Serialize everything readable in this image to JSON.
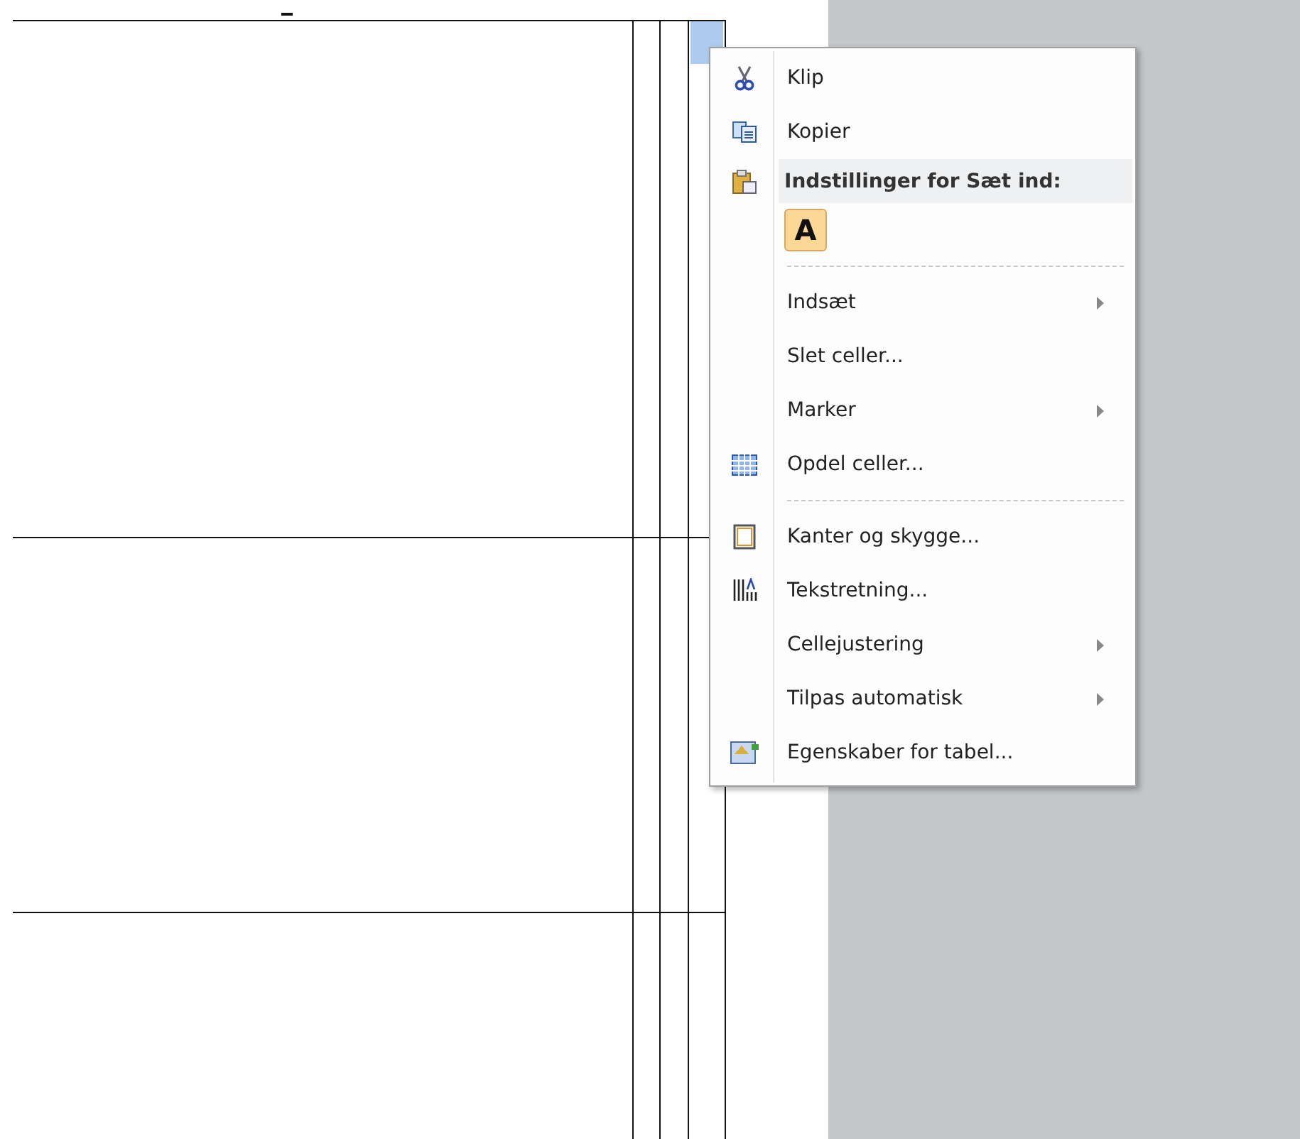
{
  "document": {
    "selected_cell": true
  },
  "context_menu": {
    "items": [
      {
        "kind": "item",
        "label": "Klip",
        "submenu": false
      },
      {
        "kind": "item",
        "label": "Kopier",
        "submenu": false
      },
      {
        "kind": "header",
        "label": "Indstillinger for Sæt ind:"
      },
      {
        "kind": "paste_options",
        "options": [
          "A"
        ]
      },
      {
        "kind": "separator"
      },
      {
        "kind": "item",
        "label": "Indsæt",
        "submenu": true
      },
      {
        "kind": "item",
        "label": "Slet celler...",
        "submenu": false
      },
      {
        "kind": "item",
        "label": "Marker",
        "submenu": true
      },
      {
        "kind": "item",
        "label": "Opdel celler...",
        "submenu": false
      },
      {
        "kind": "separator"
      },
      {
        "kind": "item",
        "label": "Kanter og skygge...",
        "submenu": false
      },
      {
        "kind": "item",
        "label": "Tekstretning...",
        "submenu": false
      },
      {
        "kind": "item",
        "label": "Cellejustering",
        "submenu": true
      },
      {
        "kind": "item",
        "label": "Tilpas automatisk",
        "submenu": true
      },
      {
        "kind": "item",
        "label": "Egenskaber for tabel...",
        "submenu": false
      }
    ]
  }
}
